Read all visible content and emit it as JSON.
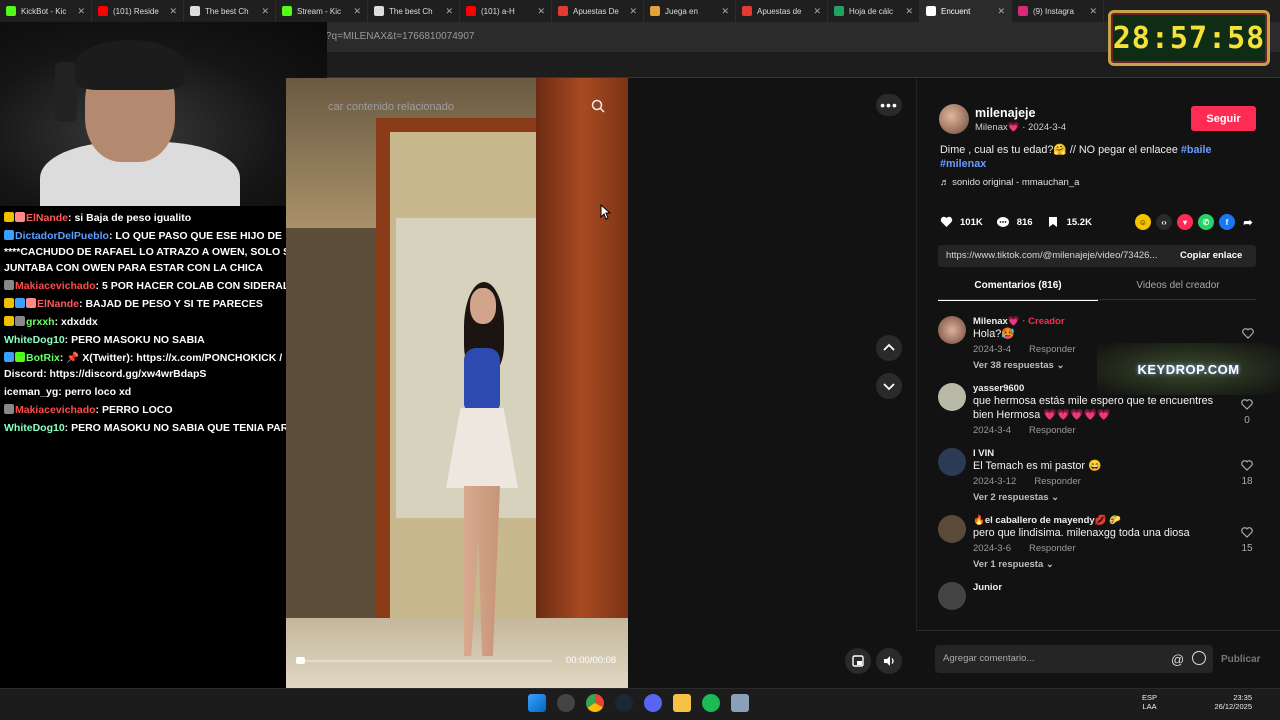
{
  "browser": {
    "tabs": [
      {
        "label": "KickBot - Kic",
        "color": "#53fc18"
      },
      {
        "label": "(101) Reside",
        "color": "#ff0000"
      },
      {
        "label": "The best Ch",
        "color": "#dddddd"
      },
      {
        "label": "Stream - Kic",
        "color": "#53fc18"
      },
      {
        "label": "The best Ch",
        "color": "#dddddd"
      },
      {
        "label": "(101) a-H",
        "color": "#ff0000"
      },
      {
        "label": "Apuestas De",
        "color": "#e53935"
      },
      {
        "label": "Juega en",
        "color": "#e2a33a"
      },
      {
        "label": "Apuestas de",
        "color": "#e53935"
      },
      {
        "label": "Hoja de cálc",
        "color": "#1fa463"
      },
      {
        "label": "Encuent",
        "color": "#ffffff",
        "active": true
      },
      {
        "label": "(9) Instagra",
        "color": "#d62976"
      }
    ],
    "url": "?q=MILENAX&t=1766810074907"
  },
  "timer": "28:57:58",
  "chat": [
    {
      "user": "ElNande",
      "color": "#ff5a5a",
      "text": "si Baja de peso igualito",
      "badges": [
        "#f0c000",
        "#ff8a8a"
      ]
    },
    {
      "user": "DictadorDelPueblo",
      "color": "#5aa0ff",
      "text": "LO QUE PASO QUE ESE HIJO DE ****CACHUDO DE RAFAEL LO ATRAZO A OWEN, SOLO SE JUNTABA CON OWEN PARA ESTAR CON LA CHICA",
      "badges": [
        "#3aa0ff"
      ]
    },
    {
      "user": "Makiacevichado",
      "color": "#ff4a4a",
      "text": "5 POR HACER COLAB CON SIDERAL",
      "badges": [
        "#888888"
      ]
    },
    {
      "user": "ElNande",
      "color": "#ff5a5a",
      "text": "BAJAD DE PESO Y SI TE PARECES",
      "badges": [
        "#f0c000",
        "#3aa0ff",
        "#ff8a8a"
      ]
    },
    {
      "user": "grxxh",
      "color": "#6aff6a",
      "text": "xdxddx",
      "badges": [
        "#f0c000",
        "#888888"
      ]
    },
    {
      "user": "WhiteDog10",
      "color": "#8affc0",
      "text": "PERO MASOKU NO SABIA",
      "badges": []
    },
    {
      "user": "BotRix",
      "color": "#6aff6a",
      "text": "📌 X(Twitter): https://x.com/PONCHOKICK / 📌 Discord: https://discord.gg/xw4wrBdapS",
      "badges": [
        "#3aa0ff",
        "#53fc18"
      ]
    },
    {
      "user": "iceman_yg",
      "color": "#ffffff",
      "text": "perro loco xd",
      "badges": []
    },
    {
      "user": "Makiacevichado",
      "color": "#ff4a4a",
      "text": "PERRO LOCO",
      "badges": [
        "#888888"
      ]
    },
    {
      "user": "WhiteDog10",
      "color": "#8affc0",
      "text": "PERO MASOKU NO SABIA QUE TENIA PAREJA",
      "badges": []
    }
  ],
  "video": {
    "search_placeholder": "car contenido relacionado",
    "time": "00:00/00:08",
    "progress": 0.0
  },
  "post": {
    "username": "milenajeje",
    "display_name": "Milenax💗",
    "date": "2024-3-4",
    "follow_label": "Seguir",
    "caption": "Dime , cual es tu edad?🤗 // NO pegar el enlacee",
    "hashtag1": "#baile",
    "hashtag2": "#milenax",
    "sound": "♬  sonido original - mmauchan_a",
    "likes": "101K",
    "comments": "816",
    "saves": "15.2K",
    "link": "https://www.tiktok.com/@milenajeje/video/73426...",
    "copy_label": "Copiar enlace",
    "tab_comments": "Comentarios (816)",
    "tab_creator": "Videos del creador"
  },
  "comments": [
    {
      "name": "Milenax💗",
      "creator_tag": "· Creador",
      "text": "Hola?🥵",
      "date": "2024-3-4",
      "reply": "Responder",
      "replies": "Ver 38 respuestas ⌄",
      "likes": ""
    },
    {
      "name": "yasser9600",
      "creator_tag": "",
      "text": "que hermosa estás mile espero que te encuentres bien Hermosa 💗💗💗💗💗",
      "date": "2024-3-4",
      "reply": "Responder",
      "replies": "",
      "likes": "0"
    },
    {
      "name": "I VIN",
      "creator_tag": "",
      "text": "El Temach es mi pastor 😄",
      "date": "2024-3-12",
      "reply": "Responder",
      "replies": "Ver 2 respuestas ⌄",
      "likes": "18"
    },
    {
      "name": "🔥el caballero de mayendy💋 🌮",
      "creator_tag": "",
      "text": "pero que lindisima. milenaxgg toda una diosa",
      "date": "2024-3-6",
      "reply": "Responder",
      "replies": "Ver 1 respuesta ⌄",
      "likes": "15"
    },
    {
      "name": "Junior",
      "creator_tag": "",
      "text": "",
      "date": "",
      "reply": "",
      "replies": "",
      "likes": ""
    }
  ],
  "keydrop_banner": "KEYDROP.COM",
  "comment_placeholder": "Agregar comentario...",
  "publish_label": "Publicar",
  "taskbar": {
    "lang1": "ESP",
    "lang2": "LAA",
    "time": "23:35",
    "date": "26/12/2025"
  }
}
